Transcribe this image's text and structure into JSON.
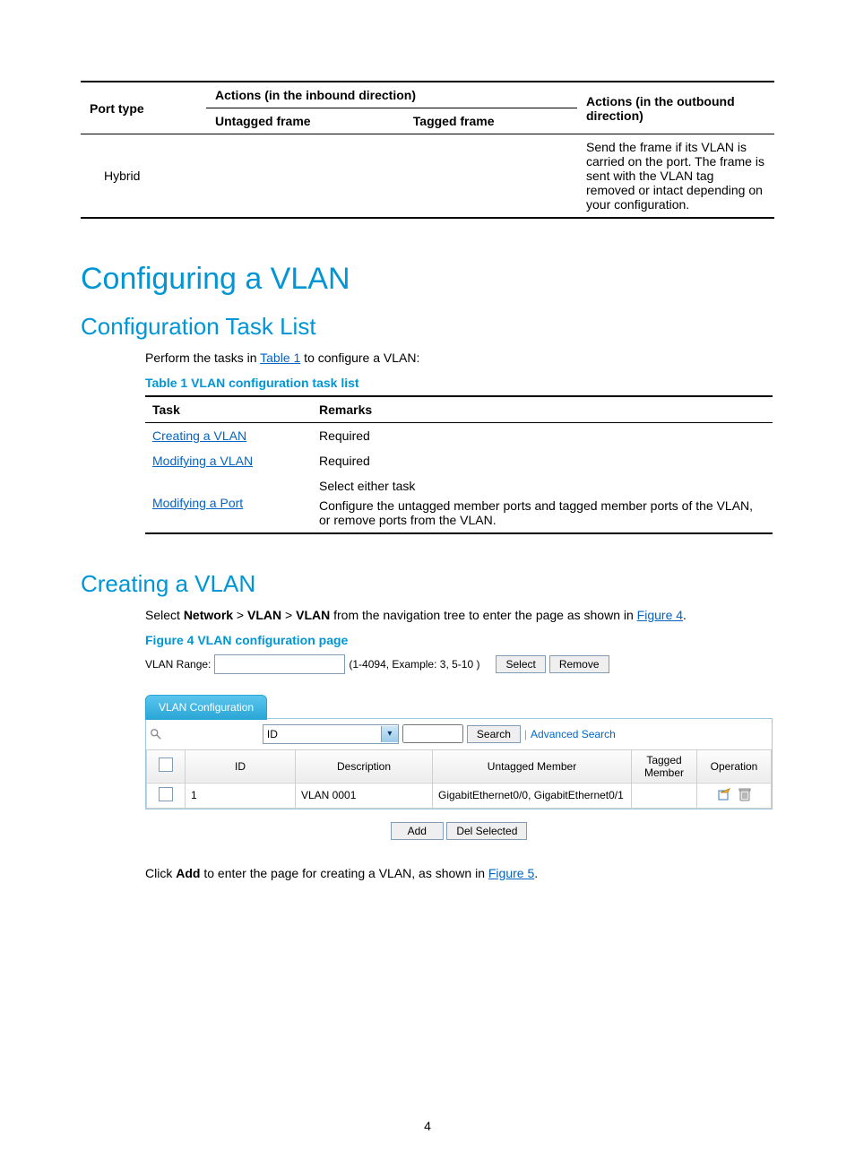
{
  "top_table": {
    "h_port_type": "Port type",
    "h_inbound": "Actions (in the inbound direction)",
    "h_untagged": "Untagged frame",
    "h_tagged": "Tagged frame",
    "h_outbound": "Actions (in the outbound direction)",
    "row_port_type": "Hybrid",
    "row_outbound": "Send the frame if its VLAN is carried on the port. The frame is sent with the VLAN tag removed or intact depending on your configuration."
  },
  "headings": {
    "h1": "Configuring a VLAN",
    "h2_tasklist": "Configuration Task List",
    "h2_creating": "Creating a VLAN"
  },
  "task_intro_pre": "Perform the tasks in ",
  "task_intro_link": "Table 1",
  "task_intro_post": " to configure a VLAN:",
  "table1_caption": "Table 1 VLAN configuration task list",
  "task_table": {
    "h_task": "Task",
    "h_remarks": "Remarks",
    "rows": [
      {
        "task": "Creating a VLAN",
        "remarks": "Required"
      },
      {
        "task": "Modifying a VLAN",
        "remarks": "Required"
      },
      {
        "task": "Modifying a Port",
        "remarks_a": "Select either task",
        "remarks_b": "Configure the untagged member ports and tagged member ports of the VLAN, or remove ports from the VLAN."
      }
    ]
  },
  "creating_para_pre": "Select ",
  "creating_b1": "Network",
  "creating_b2": "VLAN",
  "creating_b3": "VLAN",
  "creating_sep": " > ",
  "creating_para_mid": " from the navigation tree to enter the page as shown in ",
  "creating_link": "Figure 4",
  "creating_para_end": ".",
  "figure4_caption": "Figure 4 VLAN configuration page",
  "widget": {
    "range_label": "VLAN Range:",
    "range_hint": "(1-4094, Example: 3, 5-10 )",
    "btn_select": "Select",
    "btn_remove": "Remove",
    "tab_label": "VLAN Configuration",
    "search_option": "ID",
    "btn_search": "Search",
    "adv_search": "Advanced Search",
    "grid": {
      "h_id": "ID",
      "h_desc": "Description",
      "h_untagged": "Untagged Member",
      "h_tagged": "Tagged Member",
      "h_op": "Operation",
      "r1_id": "1",
      "r1_desc": "VLAN 0001",
      "r1_untagged": "GigabitEthernet0/0, GigabitEthernet0/1"
    },
    "btn_add": "Add",
    "btn_del": "Del Selected"
  },
  "closing_pre": "Click ",
  "closing_b": "Add",
  "closing_mid": " to enter the page for creating a VLAN, as shown in ",
  "closing_link": "Figure 5",
  "closing_end": ".",
  "page_number": "4"
}
